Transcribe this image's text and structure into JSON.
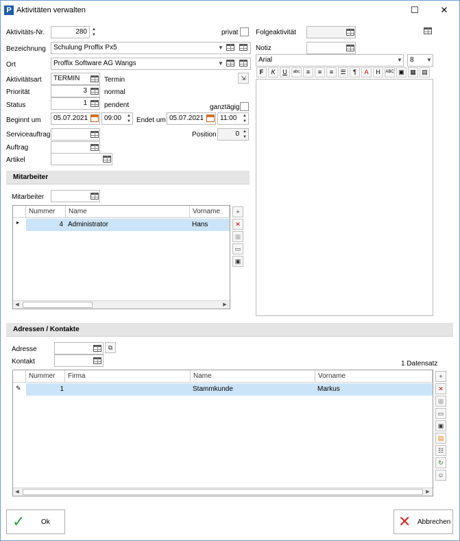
{
  "window": {
    "icon_letter": "P",
    "title": "Aktivitäten verwalten",
    "minimize": "—",
    "maximize": "☐",
    "close": "✕"
  },
  "form": {
    "aktnr_label": "Aktivitäts-Nr.",
    "aktnr_value": "280",
    "privat_label": "privat",
    "bezeichnung_label": "Bezeichnung",
    "bezeichnung_value": "Schulung Proffix Px5",
    "ort_label": "Ort",
    "ort_value": "Proffix Software AG Wangs",
    "aktart_label": "Aktivitätsart",
    "aktart_value": "TERMIN",
    "aktart_desc": "Termin",
    "prioritaet_label": "Priorität",
    "prioritaet_value": "3",
    "prioritaet_desc": "normal",
    "status_label": "Status",
    "status_value": "1",
    "status_desc": "pendent",
    "ganztaegig_label": "ganztägig",
    "beginnt_label": "Beginnt um",
    "beginnt_date": "05.07.2021",
    "beginnt_time": "09:00",
    "endet_label": "Endet um",
    "endet_date": "05.07.2021",
    "endet_time": "11:00",
    "serviceauftrag_label": "Serviceauftrag",
    "position_label": "Position",
    "position_value": "0",
    "auftrag_label": "Auftrag",
    "artikel_label": "Artikel",
    "folgeaktivitaet_label": "Folgeaktivität",
    "notiz_label": "Notiz",
    "font_value": "Arial",
    "fontsize_value": "8"
  },
  "editor_toolbar": [
    "F",
    "K",
    "U",
    "abc",
    "≡",
    "≡",
    "≡",
    "☰",
    "¶",
    "A",
    "H",
    "ABC",
    "▣",
    "▦",
    "▤"
  ],
  "mitarbeiter": {
    "section_title": "Mitarbeiter",
    "field_label": "Mitarbeiter",
    "columns": [
      "Nummer",
      "Name",
      "Vorname"
    ],
    "rows": [
      {
        "nummer": "4",
        "name": "Administrator",
        "vorname": "Hans"
      }
    ],
    "row_marker": "▸"
  },
  "adressen": {
    "section_title": "Adressen / Kontakte",
    "adresse_label": "Adresse",
    "kontakt_label": "Kontakt",
    "count_text": "1 Datensatz",
    "columns": [
      "Nummer",
      "Firma",
      "Name",
      "Vorname"
    ],
    "rows": [
      {
        "nummer": "1",
        "firma": "",
        "name": "Stammkunde",
        "vorname": "Markus"
      }
    ],
    "row_marker": "✎"
  },
  "buttons": {
    "ok": "Ok",
    "cancel": "Abbrechen"
  },
  "colors": {
    "accent": "#1f5ea8",
    "selection": "#cce4f7",
    "ok_check": "#2e9e3e",
    "cancel_x": "#d42a2a"
  }
}
